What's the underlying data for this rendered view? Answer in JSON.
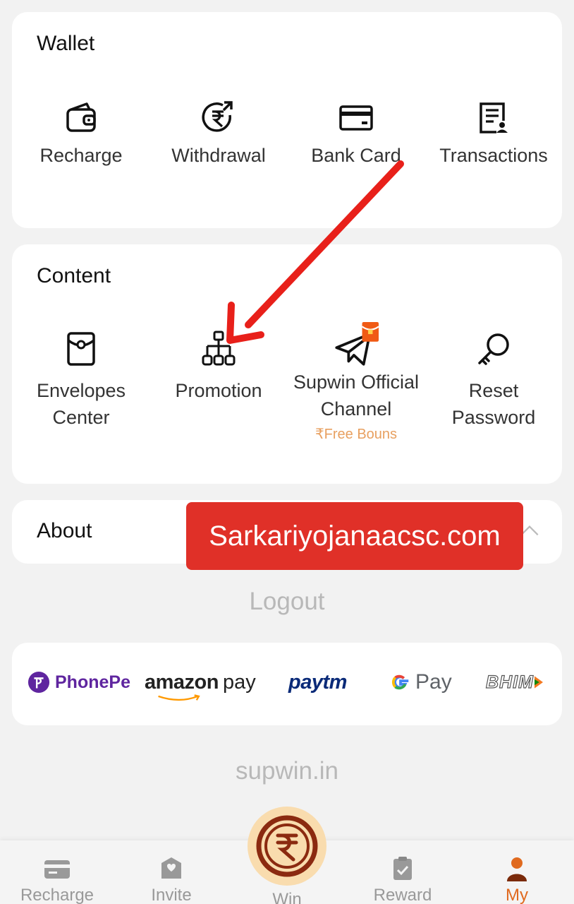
{
  "wallet": {
    "title": "Wallet",
    "items": [
      {
        "label": "Recharge",
        "icon": "wallet-icon"
      },
      {
        "label": "Withdrawal",
        "icon": "rupee-withdraw-icon"
      },
      {
        "label": "Bank Card",
        "icon": "bank-card-icon"
      },
      {
        "label": "Transactions",
        "icon": "transactions-icon"
      }
    ]
  },
  "content": {
    "title": "Content",
    "items": [
      {
        "label": "Envelopes\nCenter",
        "icon": "envelope-icon"
      },
      {
        "label": "Promotion",
        "icon": "promotion-tree-icon"
      },
      {
        "label": "Supwin Official\nChannel",
        "icon": "telegram-icon",
        "sub": "₹Free Bouns"
      },
      {
        "label": "Reset Password",
        "icon": "key-icon"
      }
    ]
  },
  "about": {
    "title": "About"
  },
  "watermark": "Sarkariyojanaacsc.com",
  "logout": "Logout",
  "payments": [
    "PhonePe",
    "amazon",
    "pay",
    "paytm",
    "Pay",
    "BHIM"
  ],
  "domain": "supwin.in",
  "nav": [
    {
      "label": "Recharge",
      "icon": "card-icon"
    },
    {
      "label": "Invite",
      "icon": "invite-icon"
    },
    {
      "label": "Win",
      "icon": "rupee-coin-icon"
    },
    {
      "label": "Reward",
      "icon": "clipboard-check-icon"
    },
    {
      "label": "My",
      "icon": "user-icon"
    }
  ],
  "colors": {
    "accent": "#e06a1f",
    "arrow": "#e8201a",
    "bonus": "#e8a060"
  }
}
